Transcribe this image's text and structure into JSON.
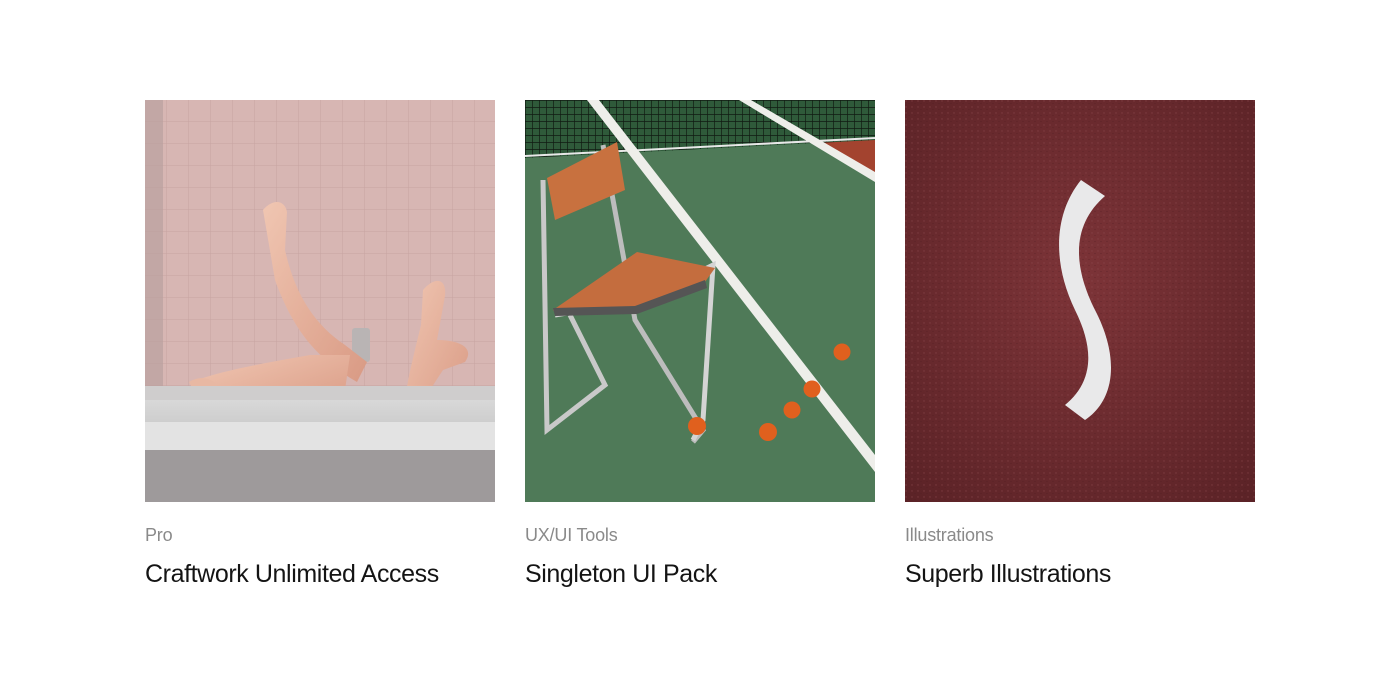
{
  "cards": [
    {
      "category": "Pro",
      "title": "Craftwork Unlimited Access",
      "image": "bathtub-legs-photo"
    },
    {
      "category": "UX/UI Tools",
      "title": "Singleton UI Pack",
      "image": "tennis-court-chair-photo"
    },
    {
      "category": "Illustrations",
      "title": "Superb Illustrations",
      "image": "red-track-white-curve-photo"
    }
  ],
  "colors": {
    "category_text": "#8a8a8a",
    "title_text": "#141414",
    "background": "#ffffff"
  }
}
